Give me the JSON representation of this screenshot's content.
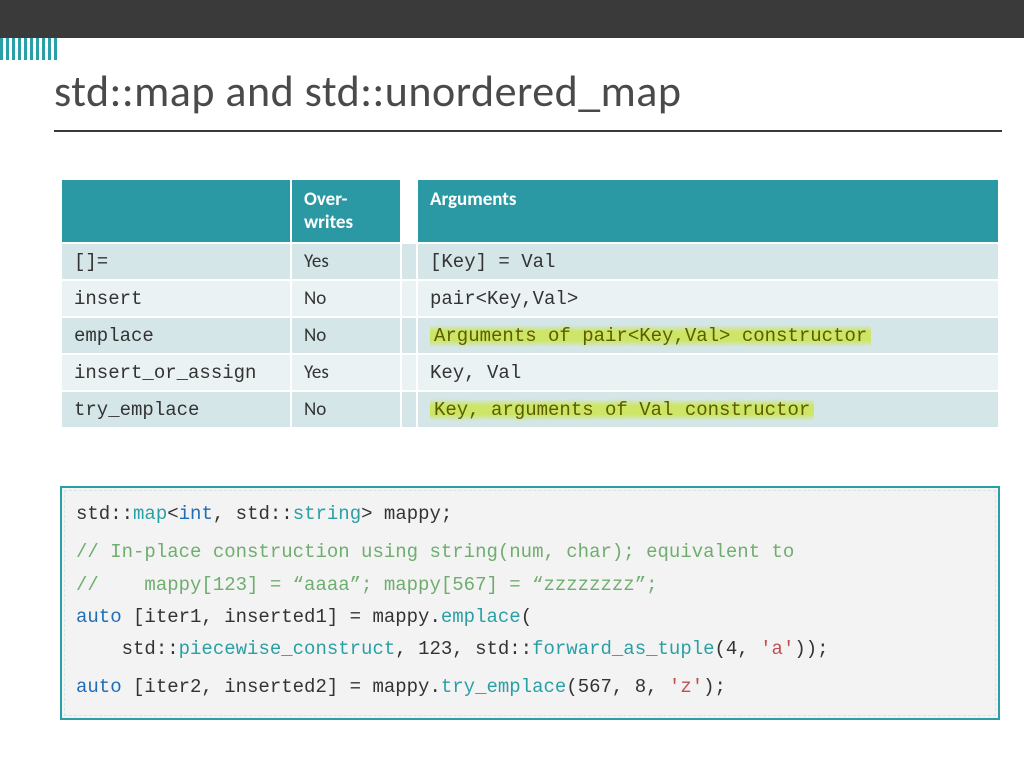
{
  "title": "std::map and std::unordered_map",
  "table": {
    "headers": {
      "method": "",
      "overwrites": "Over-\nwrites",
      "spacer": "",
      "arguments": "Arguments"
    },
    "rows": [
      {
        "method": "[]=",
        "overwrites": "Yes",
        "arguments": "[Key] = Val",
        "hl": false
      },
      {
        "method": "insert",
        "overwrites": "No",
        "arguments": "pair<Key,Val>",
        "hl": false
      },
      {
        "method": "emplace",
        "overwrites": "No",
        "arguments": "Arguments of pair<Key,Val> constructor",
        "hl": true
      },
      {
        "method": "insert_or_assign",
        "overwrites": "Yes",
        "arguments": "Key, Val",
        "hl": false
      },
      {
        "method": "try_emplace",
        "overwrites": "No",
        "arguments": "Key, arguments of Val constructor",
        "hl": true
      }
    ]
  },
  "code": {
    "l1a": "std::",
    "l1b": "map",
    "l1c": "<",
    "l1d": "int",
    "l1e": ", std::",
    "l1f": "string",
    "l1g": "> mappy;",
    "l2": "// In-place construction using string(num, char); equivalent to",
    "l3": "//    mappy[123] = “aaaa”; mappy[567] = “zzzzzzzz”;",
    "l4a": "auto",
    "l4b": " [iter1, inserted1] = mappy.",
    "l4c": "emplace",
    "l4d": "(",
    "l5a": "    std::",
    "l5b": "piecewise_construct",
    "l5c": ", 123, std::",
    "l5d": "forward_as_tuple",
    "l5e": "(4, ",
    "l5f": "'a'",
    "l5g": "));",
    "l6a": "auto",
    "l6b": " [iter2, inserted2] = mappy.",
    "l6c": "try_emplace",
    "l6d": "(567, 8, ",
    "l6e": "'z'",
    "l6f": ");"
  }
}
